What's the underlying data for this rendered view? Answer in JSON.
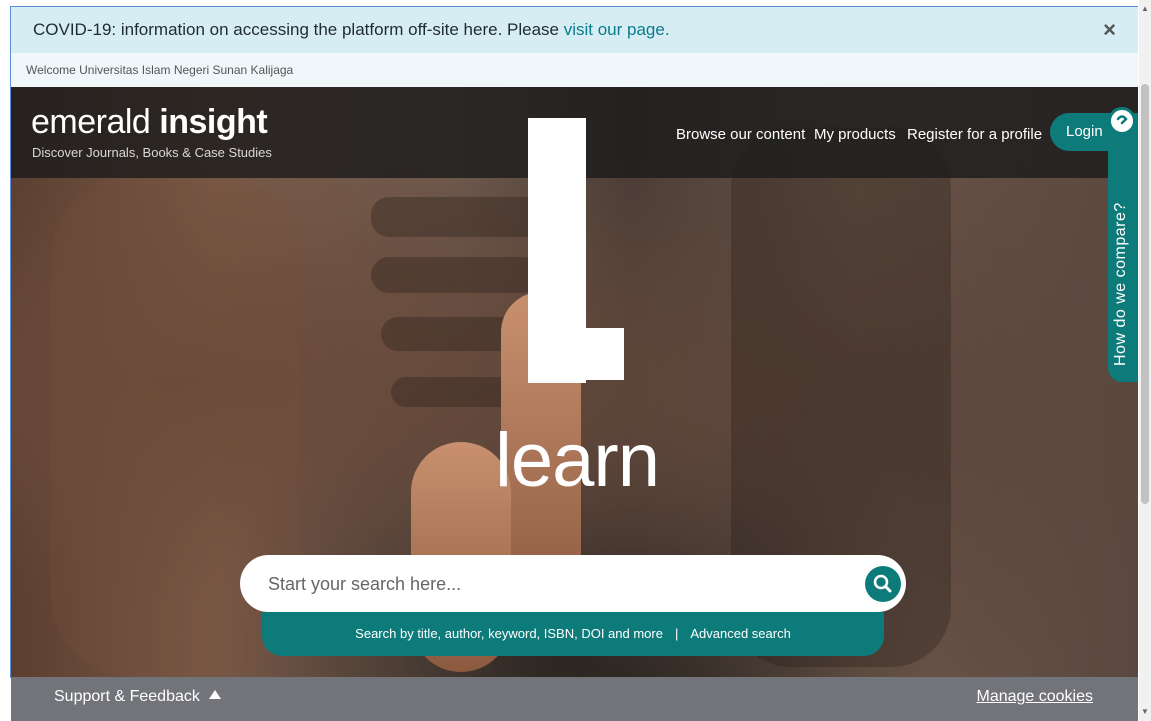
{
  "banner": {
    "text": "COVID-19: information on accessing the platform off-site here. Please ",
    "link": "visit our page.",
    "close": "×"
  },
  "welcome": "Welcome Universitas Islam Negeri Sunan Kalijaga",
  "logo": {
    "light": "emerald ",
    "bold": "insight",
    "tagline": "Discover Journals, Books & Case Studies"
  },
  "nav": {
    "browse": "Browse our content",
    "products": "My products",
    "register": "Register for a profile",
    "login": "Login"
  },
  "hero": {
    "word": "learn"
  },
  "search": {
    "placeholder": "Start your search here...",
    "hint": "Search by title, author, keyword, ISBN, DOI and more",
    "separator": "|",
    "advanced": "Advanced search"
  },
  "side_tab": {
    "label": "How do we compare?"
  },
  "footer": {
    "support": "Support & Feedback",
    "manage": "Manage cookies"
  },
  "colors": {
    "brand": "#0e7b7b",
    "banner_bg": "#d7edf4",
    "footer_bg": "#72747a"
  },
  "icons": {
    "search": "search-icon",
    "close": "close-icon",
    "caret": "caret-up-icon",
    "help": "help-icon"
  }
}
